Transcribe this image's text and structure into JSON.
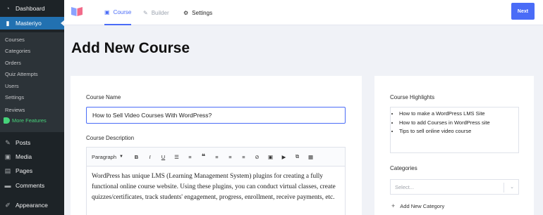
{
  "wp_menu": {
    "dashboard": "Dashboard",
    "masteriyo": "Masteriyo",
    "posts": "Posts",
    "media": "Media",
    "pages": "Pages",
    "comments": "Comments",
    "appearance": "Appearance",
    "sub": [
      "Courses",
      "Categories",
      "Orders",
      "Quiz Attempts",
      "Users",
      "Settings",
      "Reviews"
    ],
    "more_features": "More Features"
  },
  "header": {
    "tabs": [
      {
        "label": "Course",
        "icon": "book-icon",
        "state": "current"
      },
      {
        "label": "Builder",
        "icon": "edit-icon",
        "state": "disabled"
      },
      {
        "label": "Settings",
        "icon": "gear-icon",
        "state": "normal"
      }
    ],
    "next_label": "Next",
    "accent": "#4a6cf7"
  },
  "page_title": "Add New Course",
  "form": {
    "course_name_label": "Course Name",
    "course_name_value": "How to Sell Video Courses With WordPress?",
    "description_label": "Course Description",
    "paragraph_select": "Paragraph",
    "description_text": "WordPress has unique LMS (Learning Management System) plugins for creating a fully functional online course website. Using these plugins, you can conduct virtual classes, create quizzes/certificates, track students' engagement, progress, enrollment, receive payments, etc."
  },
  "sidebar": {
    "highlights_label": "Course Highlights",
    "highlights": [
      "How to make a WordPress LMS Site",
      "How to add Courses in WordPress site",
      "Tips to sell online video course"
    ],
    "categories_label": "Categories",
    "categories_placeholder": "Select...",
    "add_category_label": "Add New Category"
  }
}
